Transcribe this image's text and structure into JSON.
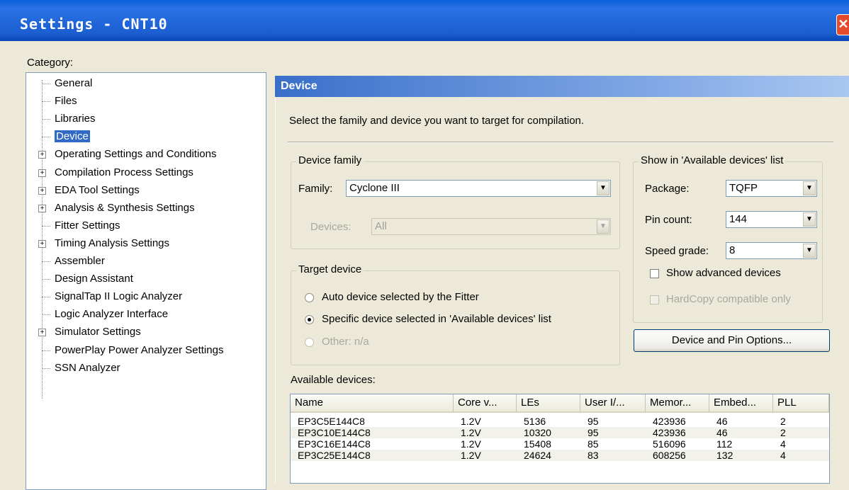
{
  "window": {
    "title": "Settings - CNT10",
    "close_glyph": "✕"
  },
  "category_label": "Category:",
  "tree": [
    {
      "label": "General",
      "expandable": false,
      "selected": false
    },
    {
      "label": "Files",
      "expandable": false,
      "selected": false
    },
    {
      "label": "Libraries",
      "expandable": false,
      "selected": false
    },
    {
      "label": "Device",
      "expandable": false,
      "selected": true
    },
    {
      "label": "Operating Settings and Conditions",
      "expandable": true,
      "selected": false
    },
    {
      "label": "Compilation Process Settings",
      "expandable": true,
      "selected": false
    },
    {
      "label": "EDA Tool Settings",
      "expandable": true,
      "selected": false
    },
    {
      "label": "Analysis & Synthesis Settings",
      "expandable": true,
      "selected": false
    },
    {
      "label": "Fitter Settings",
      "expandable": false,
      "selected": false
    },
    {
      "label": "Timing Analysis Settings",
      "expandable": true,
      "selected": false
    },
    {
      "label": "Assembler",
      "expandable": false,
      "selected": false
    },
    {
      "label": "Design Assistant",
      "expandable": false,
      "selected": false
    },
    {
      "label": "SignalTap II Logic Analyzer",
      "expandable": false,
      "selected": false
    },
    {
      "label": "Logic Analyzer Interface",
      "expandable": false,
      "selected": false
    },
    {
      "label": "Simulator Settings",
      "expandable": true,
      "selected": false
    },
    {
      "label": "PowerPlay Power Analyzer Settings",
      "expandable": false,
      "selected": false
    },
    {
      "label": "SSN Analyzer",
      "expandable": false,
      "selected": false
    }
  ],
  "panel": {
    "title": "Device",
    "description": "Select the family and device you want to target for compilation."
  },
  "device_family": {
    "legend": "Device family",
    "family_label": "Family:",
    "family_value": "Cyclone III",
    "devices_label": "Devices:",
    "devices_value": "All"
  },
  "target_device": {
    "legend": "Target device",
    "options": [
      {
        "label": "Auto device selected by the Fitter",
        "checked": false,
        "disabled": false
      },
      {
        "label": "Specific device selected in 'Available devices' list",
        "checked": true,
        "disabled": false
      },
      {
        "label": "Other:  n/a",
        "checked": false,
        "disabled": true
      }
    ]
  },
  "show_in_list": {
    "legend": "Show in 'Available devices' list",
    "package_label": "Package:",
    "package_value": "TQFP",
    "pin_count_label": "Pin count:",
    "pin_count_value": "144",
    "speed_grade_label": "Speed grade:",
    "speed_grade_value": "8",
    "show_advanced_label": "Show advanced devices",
    "show_advanced_checked": false,
    "hardcopy_label": "HardCopy compatible only",
    "hardcopy_checked": false
  },
  "device_pin_options_button": "Device and Pin Options...",
  "available_devices": {
    "label": "Available devices:",
    "columns": [
      "Name",
      "Core v...",
      "LEs",
      "User I/...",
      "Memor...",
      "Embed...",
      "PLL"
    ],
    "rows": [
      [
        "EP3C5E144C8",
        "1.2V",
        "5136",
        "95",
        "423936",
        "46",
        "2"
      ],
      [
        "EP3C10E144C8",
        "1.2V",
        "10320",
        "95",
        "423936",
        "46",
        "2"
      ],
      [
        "EP3C16E144C8",
        "1.2V",
        "15408",
        "85",
        "516096",
        "112",
        "4"
      ],
      [
        "EP3C25E144C8",
        "1.2V",
        "24624",
        "83",
        "608256",
        "132",
        "4"
      ]
    ]
  },
  "icons": {
    "expander": "plus-box",
    "dropdown": "▼"
  },
  "colors": {
    "titlebar": "#0a5fd8",
    "selection": "#316ac5",
    "close": "#e44b2c"
  }
}
